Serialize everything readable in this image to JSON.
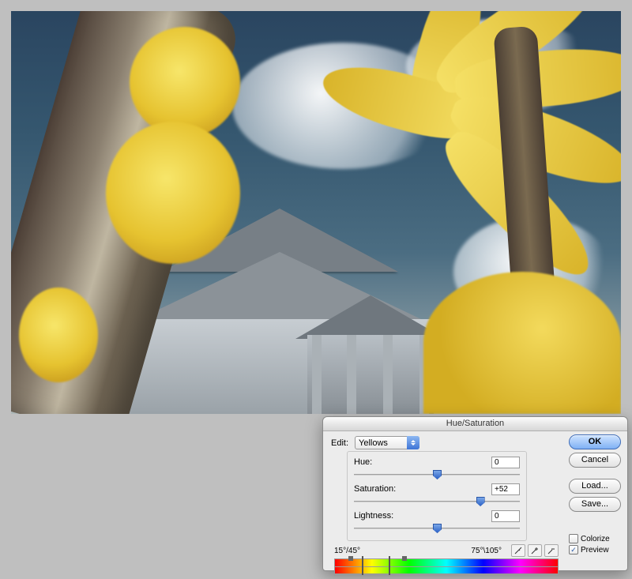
{
  "dialog": {
    "title": "Hue/Saturation",
    "edit_label": "Edit:",
    "edit_value": "Yellows",
    "hue": {
      "label": "Hue:",
      "value": "0",
      "pos": 50
    },
    "saturation": {
      "label": "Saturation:",
      "value": "+52",
      "pos": 76
    },
    "lightness": {
      "label": "Lightness:",
      "value": "0",
      "pos": 50
    },
    "range_left": "15°/45°",
    "range_right": "75°\\105°",
    "buttons": {
      "ok": "OK",
      "cancel": "Cancel",
      "load": "Load...",
      "save": "Save..."
    },
    "colorize_label": "Colorize",
    "preview_label": "Preview",
    "preview_checked": true,
    "colorize_checked": false,
    "eyedropper": "eyedropper",
    "eyedropper_plus": "eyedropper-plus",
    "eyedropper_minus": "eyedropper-minus"
  }
}
